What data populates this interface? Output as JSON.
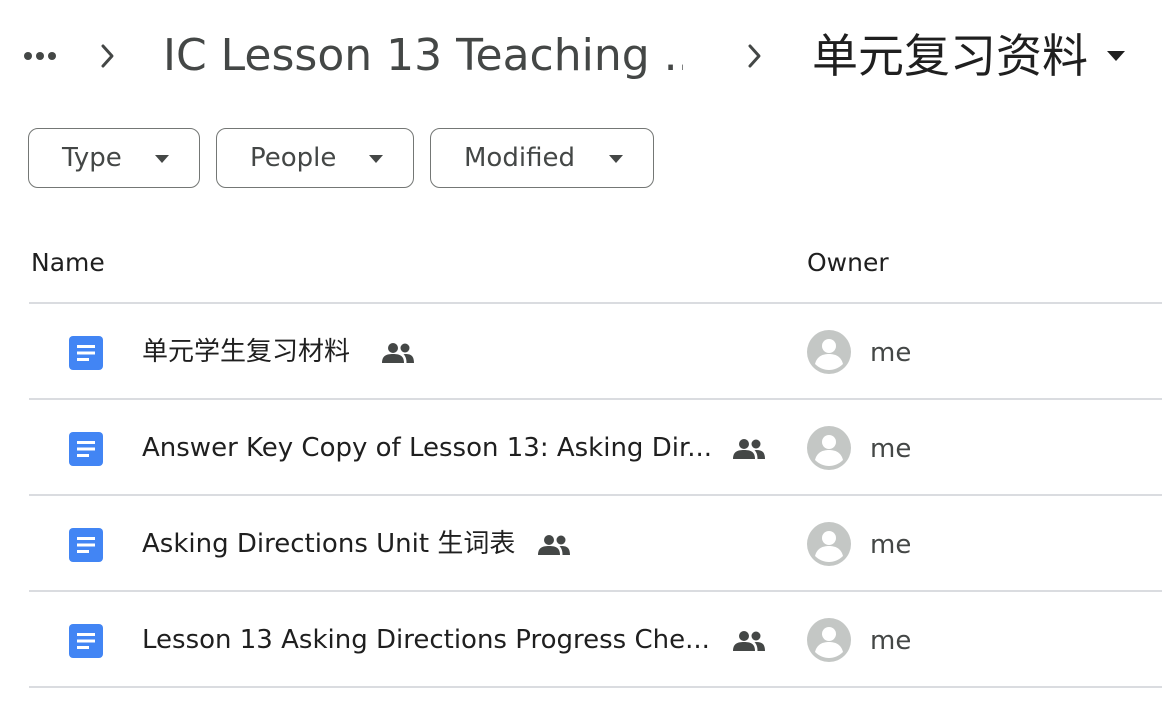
{
  "breadcrumb": {
    "more_icon": "more-horiz-icon",
    "separator_icon": "chevron-right-icon",
    "parent_folder": "IC Lesson 13 Teaching ...",
    "current_folder": "单元复习资料",
    "current_caret_icon": "arrow-drop-down-icon"
  },
  "filters": {
    "type_label": "Type",
    "people_label": "People",
    "modified_label": "Modified"
  },
  "table": {
    "columns": {
      "name": "Name",
      "owner": "Owner"
    },
    "rows": [
      {
        "name": "单元学生复习材料",
        "owner": "me",
        "file_icon": "google-docs-icon",
        "shared": true
      },
      {
        "name": "Answer Key Copy of Lesson 13: Asking Dir...",
        "owner": "me",
        "file_icon": "google-docs-icon",
        "shared": true
      },
      {
        "name": "Asking Directions Unit 生词表",
        "owner": "me",
        "file_icon": "google-docs-icon",
        "shared": true
      },
      {
        "name": "Lesson 13 Asking Directions Progress Che...",
        "owner": "me",
        "file_icon": "google-docs-icon",
        "shared": true
      }
    ]
  },
  "colors": {
    "docs_blue": "#4285f4",
    "icon_gray": "#444746",
    "avatar_gray": "#c4c7c5",
    "divider": "#dadce0"
  }
}
